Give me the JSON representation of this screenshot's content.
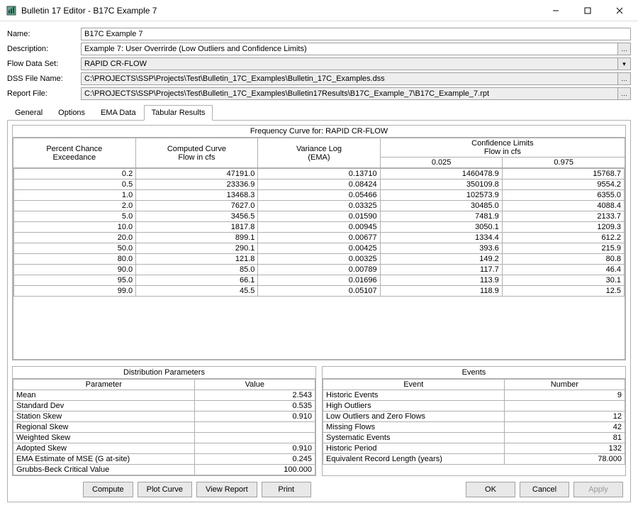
{
  "window": {
    "title": "Bulletin 17 Editor - B17C Example 7"
  },
  "form": {
    "name_label": "Name:",
    "name_value": "B17C Example 7",
    "description_label": "Description:",
    "description_value": "Example 7: User Overrirde (Low Outliers and Confidence Limits)",
    "flowdataset_label": "Flow Data Set:",
    "flowdataset_value": "RAPID CR-FLOW",
    "dssfile_label": "DSS File Name:",
    "dssfile_value": "C:\\PROJECTS\\SSP\\Projects\\Test\\Bulletin_17C_Examples\\Bulletin_17C_Examples.dss",
    "reportfile_label": "Report File:",
    "reportfile_value": "C:\\PROJECTS\\SSP\\Projects\\Test\\Bulletin_17C_Examples\\Bulletin17Results\\B17C_Example_7\\B17C_Example_7.rpt"
  },
  "tabs": {
    "general": "General",
    "options": "Options",
    "ema": "EMA Data",
    "tabular": "Tabular Results"
  },
  "freq": {
    "title": "Frequency Curve for: RAPID CR-FLOW",
    "h_percent_1": "Percent Chance",
    "h_percent_2": "Exceedance",
    "h_computed_1": "Computed Curve",
    "h_computed_2": "Flow in cfs",
    "h_variance_1": "Variance Log",
    "h_variance_2": "(EMA)",
    "h_conf_1": "Confidence Limits",
    "h_conf_2": "Flow in cfs",
    "h_025": "0.025",
    "h_975": "0.975",
    "rows": [
      {
        "p": "0.2",
        "c": "47191.0",
        "v": "0.13710",
        "lo": "1460478.9",
        "hi": "15768.7"
      },
      {
        "p": "0.5",
        "c": "23336.9",
        "v": "0.08424",
        "lo": "350109.8",
        "hi": "9554.2"
      },
      {
        "p": "1.0",
        "c": "13468.3",
        "v": "0.05466",
        "lo": "102573.9",
        "hi": "6355.0"
      },
      {
        "p": "2.0",
        "c": "7627.0",
        "v": "0.03325",
        "lo": "30485.0",
        "hi": "4088.4"
      },
      {
        "p": "5.0",
        "c": "3456.5",
        "v": "0.01590",
        "lo": "7481.9",
        "hi": "2133.7"
      },
      {
        "p": "10.0",
        "c": "1817.8",
        "v": "0.00945",
        "lo": "3050.1",
        "hi": "1209.3"
      },
      {
        "p": "20.0",
        "c": "899.1",
        "v": "0.00677",
        "lo": "1334.4",
        "hi": "612.2"
      },
      {
        "p": "50.0",
        "c": "290.1",
        "v": "0.00425",
        "lo": "393.6",
        "hi": "215.9"
      },
      {
        "p": "80.0",
        "c": "121.8",
        "v": "0.00325",
        "lo": "149.2",
        "hi": "80.8"
      },
      {
        "p": "90.0",
        "c": "85.0",
        "v": "0.00789",
        "lo": "117.7",
        "hi": "46.4"
      },
      {
        "p": "95.0",
        "c": "66.1",
        "v": "0.01696",
        "lo": "113.9",
        "hi": "30.1"
      },
      {
        "p": "99.0",
        "c": "45.5",
        "v": "0.05107",
        "lo": "118.9",
        "hi": "12.5"
      }
    ]
  },
  "dist": {
    "title": "Distribution Parameters",
    "h_param": "Parameter",
    "h_value": "Value",
    "rows": [
      {
        "n": "Mean",
        "v": "2.543"
      },
      {
        "n": "Standard Dev",
        "v": "0.535"
      },
      {
        "n": "Station Skew",
        "v": "0.910"
      },
      {
        "n": "Regional Skew",
        "v": ""
      },
      {
        "n": "Weighted Skew",
        "v": ""
      },
      {
        "n": "Adopted Skew",
        "v": "0.910"
      },
      {
        "n": "EMA Estimate of MSE (G at-site)",
        "v": "0.245"
      },
      {
        "n": "Grubbs-Beck Critical Value",
        "v": "100.000"
      }
    ]
  },
  "events": {
    "title": "Events",
    "h_event": "Event",
    "h_number": "Number",
    "rows": [
      {
        "n": "Historic Events",
        "v": "9"
      },
      {
        "n": "High Outliers",
        "v": ""
      },
      {
        "n": "Low Outliers and Zero Flows",
        "v": "12"
      },
      {
        "n": "Missing Flows",
        "v": "42"
      },
      {
        "n": "Systematic Events",
        "v": "81"
      },
      {
        "n": "Historic Period",
        "v": "132"
      },
      {
        "n": "Equivalent Record Length (years)",
        "v": "78.000"
      }
    ]
  },
  "buttons": {
    "compute": "Compute",
    "plotcurve": "Plot Curve",
    "viewreport": "View Report",
    "print": "Print",
    "ok": "OK",
    "cancel": "Cancel",
    "apply": "Apply"
  }
}
